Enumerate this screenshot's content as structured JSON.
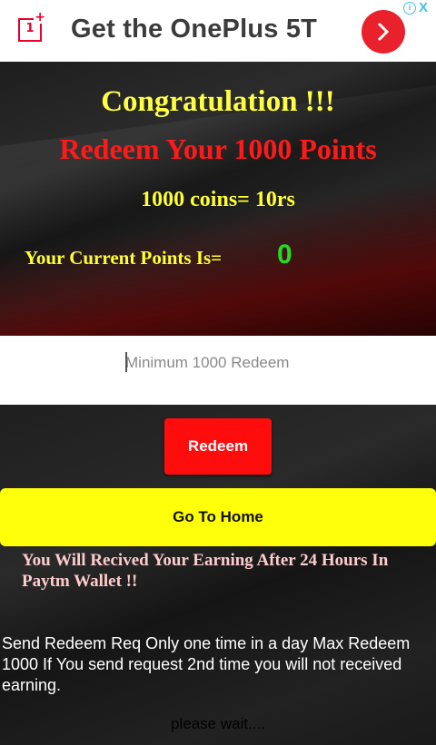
{
  "ad": {
    "logo_text": "1",
    "title": "Get the OnePlus 5T",
    "go_icon": "chevron-right-icon",
    "info_icon": "i",
    "close_icon": "X"
  },
  "hero": {
    "congrats": "Congratulation !!!",
    "redeem_heading": "Redeem Your 1000 Points",
    "rate": "1000 coins= 10rs",
    "points_label": "Your Current Points Is=",
    "points_value": "0"
  },
  "redeem_input": {
    "placeholder": "Minimum 1000 Redeem",
    "value": ""
  },
  "buttons": {
    "redeem": "Redeem",
    "home": "Go To Home"
  },
  "earning_note": "You Will Recived Your Earning After  24 Hours In Paytm Wallet !!",
  "info_note": "Send Redeem Req Only one time in a day Max Redeem 1000 If You send request 2nd time you will not received earning.",
  "status": "please wait....",
  "colors": {
    "congrats": "#ffff44",
    "redeem_heading": "#ff1a1a",
    "points_value": "#22dd22",
    "redeem_button": "#ff0d0d",
    "home_button": "#ffff0a"
  }
}
